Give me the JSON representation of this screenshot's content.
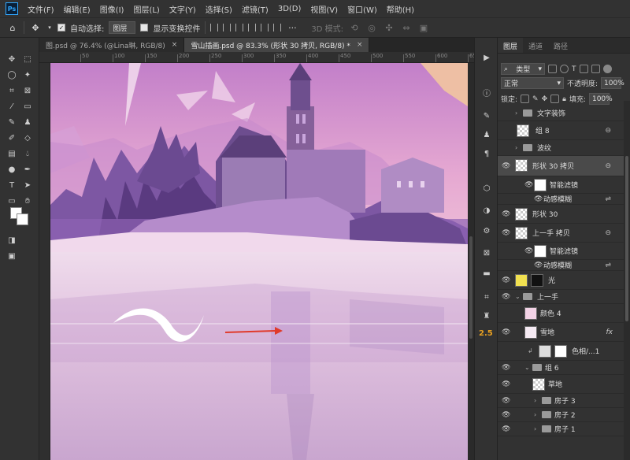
{
  "app": {
    "logo": "Ps"
  },
  "menu": [
    "文件(F)",
    "编辑(E)",
    "图像(I)",
    "图层(L)",
    "文字(Y)",
    "选择(S)",
    "滤镜(T)",
    "3D(D)",
    "视图(V)",
    "窗口(W)",
    "帮助(H)"
  ],
  "options": {
    "auto_select_label": "自动选择:",
    "auto_select_value": "图层",
    "show_transform_label": "显示变换控件",
    "mode_3d": "3D 模式:"
  },
  "tabs": [
    {
      "label": "图.psd @ 76.4% (@Lina琳, RGB/8)",
      "close": "×"
    },
    {
      "label": "雪山插画.psd @ 83.3% (形状 30 拷贝, RGB/8) *",
      "close": "×"
    }
  ],
  "ruler": [
    "50",
    "100",
    "150",
    "200",
    "250",
    "300",
    "350",
    "400",
    "450",
    "500",
    "550",
    "600",
    "650"
  ],
  "icons": {
    "home": "home-icon",
    "move": "move-tool-icon"
  },
  "colors": {
    "accent_arrow": "#e03a2a",
    "sky_top": "#c98ed1",
    "water": "#e6d4e8",
    "castle": "#6e4f8e",
    "selected_layer": "#4a4a4a"
  },
  "strip_number": "2.5",
  "panel": {
    "tabs": [
      "图层",
      "通道",
      "路径"
    ],
    "filter_label": "类型",
    "blend_mode": "正常",
    "opacity_label": "不透明度:",
    "opacity_value": "100%",
    "lock_label": "锁定:",
    "fill_label": "填充:",
    "fill_value": "100%",
    "layers": [
      {
        "name": "文字装饰",
        "type": "group"
      },
      {
        "name": "组 8",
        "type": "smart"
      },
      {
        "name": "波纹",
        "type": "group"
      },
      {
        "name": "形状 30 拷贝",
        "type": "smart",
        "selected": true
      },
      {
        "name": "智能滤镜",
        "type": "filter"
      },
      {
        "name": "动感模糊",
        "type": "effect"
      },
      {
        "name": "形状 30",
        "type": "layer"
      },
      {
        "name": "上一手 拷贝",
        "type": "smart"
      },
      {
        "name": "智能滤镜",
        "type": "filter"
      },
      {
        "name": "动感模糊",
        "type": "effect"
      },
      {
        "name": "光",
        "type": "layer"
      },
      {
        "name": "上一手",
        "type": "group"
      },
      {
        "name": "颜色 4",
        "type": "layer"
      },
      {
        "name": "雪地",
        "type": "layer",
        "fx": "fx"
      },
      {
        "name": "色相/...1",
        "type": "adjust"
      },
      {
        "name": "组 6",
        "type": "group"
      },
      {
        "name": "草地",
        "type": "layer"
      },
      {
        "name": "房子 3",
        "type": "group"
      },
      {
        "name": "房子 2",
        "type": "group"
      },
      {
        "name": "房子 1",
        "type": "group"
      }
    ]
  }
}
